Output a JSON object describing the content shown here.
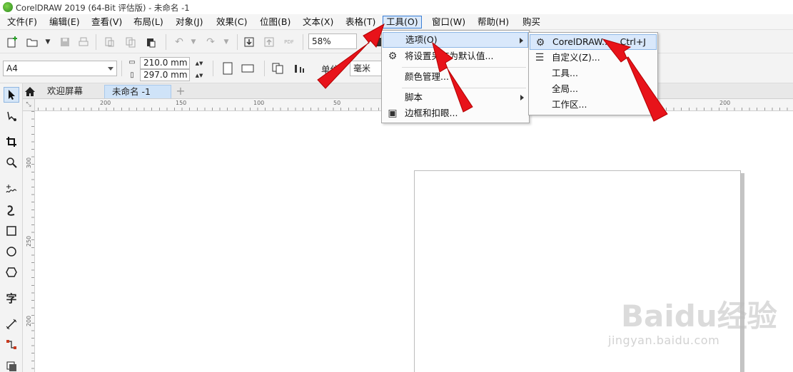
{
  "window": {
    "title": "CorelDRAW 2019 (64-Bit 评估版) - 未命名 -1"
  },
  "menubar": {
    "items": [
      "文件(F)",
      "编辑(E)",
      "查看(V)",
      "布局(L)",
      "对象(J)",
      "效果(C)",
      "位图(B)",
      "文本(X)",
      "表格(T)",
      "工具(O)",
      "窗口(W)",
      "帮助(H)",
      "购买"
    ]
  },
  "toolbar": {
    "zoom": "58%",
    "page_size": "A4",
    "width": "210.0 mm",
    "height": "297.0 mm",
    "units_label": "单位",
    "units_value": "毫米",
    "pdf_label": "PDF"
  },
  "tabs": {
    "home": "欢迎屏幕",
    "document": "未命名 -1"
  },
  "rulers": {
    "h_labels": [
      "200",
      "150",
      "100",
      "50",
      "50",
      "200"
    ],
    "v_labels": [
      "300",
      "250",
      "200"
    ]
  },
  "tools_menu": {
    "items": [
      {
        "label": "选项(O)",
        "has_submenu": true,
        "icon": ""
      },
      {
        "label": "将设置另存为默认值...",
        "icon": "gear-icon"
      },
      {
        "label": "颜色管理...",
        "icon": ""
      },
      {
        "label": "脚本",
        "has_submenu": true,
        "icon": ""
      },
      {
        "label": "边框和扣眼...",
        "icon": "frame-icon"
      }
    ]
  },
  "options_submenu": {
    "items": [
      {
        "label": "CorelDRAW...",
        "shortcut": "Ctrl+J",
        "icon": "gear-icon"
      },
      {
        "label": "自定义(Z)...",
        "icon": "sliders-icon"
      },
      {
        "label": "工具...",
        "icon": ""
      },
      {
        "label": "全局...",
        "icon": ""
      },
      {
        "label": "工作区...",
        "icon": ""
      }
    ]
  },
  "watermark": {
    "text": "Baidu经验",
    "url": "jingyan.baidu.com"
  },
  "colors": {
    "accent": "#3a7fd5",
    "highlight": "#d9e8fb",
    "arrow": "#e8131a"
  }
}
